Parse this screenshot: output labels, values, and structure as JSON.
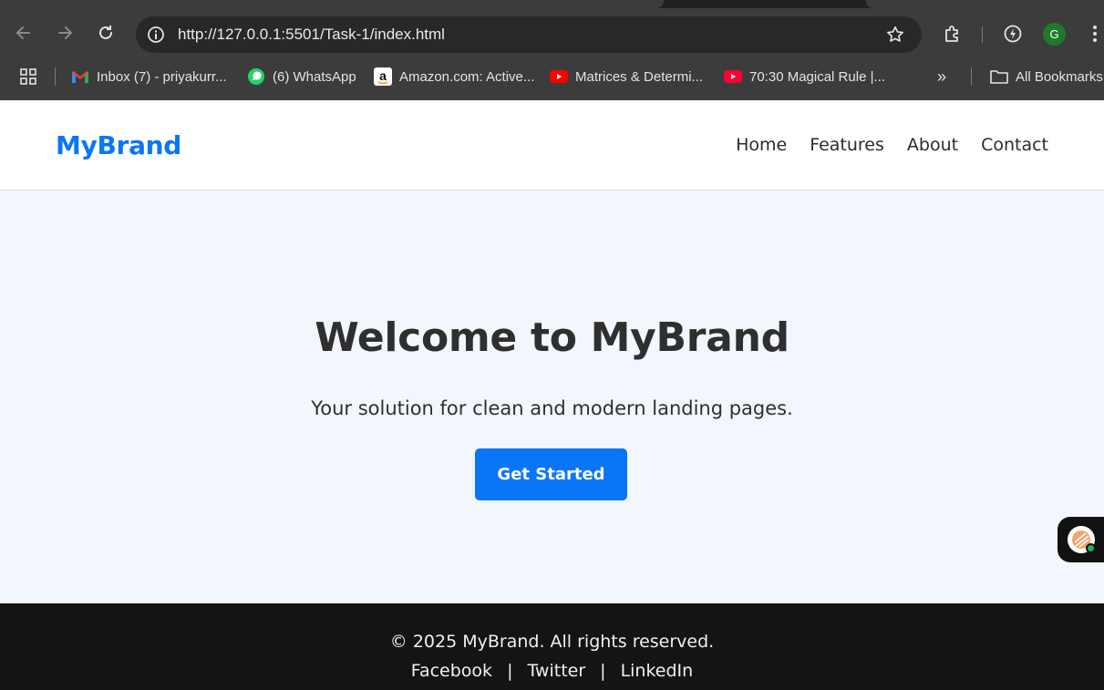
{
  "browser": {
    "url": "http://127.0.0.1:5501/Task-1/index.html",
    "profile_initial": "G",
    "bookmarks": [
      {
        "label": "Inbox (7) - priyakurr...",
        "icon": "gmail-icon"
      },
      {
        "label": "(6) WhatsApp",
        "icon": "whatsapp-icon"
      },
      {
        "label": "Amazon.com: Active...",
        "icon": "amazon-icon"
      },
      {
        "label": "Matrices & Determi...",
        "icon": "youtube-icon"
      },
      {
        "label": "70:30 Magical Rule |...",
        "icon": "youtube-icon"
      }
    ],
    "overflow_label": "»",
    "all_bookmarks_label": "All Bookmarks"
  },
  "header": {
    "brand": "MyBrand",
    "nav": [
      "Home",
      "Features",
      "About",
      "Contact"
    ]
  },
  "hero": {
    "title": "Welcome to MyBrand",
    "subtitle": "Your solution for clean and modern landing pages.",
    "cta_label": "Get Started"
  },
  "footer": {
    "copyright": "© 2025 MyBrand. All rights reserved.",
    "links": [
      "Facebook",
      "Twitter",
      "LinkedIn"
    ],
    "separator": "|"
  },
  "colors": {
    "accent": "#0a76f6",
    "hero_bg": "#f2f7fd",
    "footer_bg": "#141414",
    "chrome_bg": "#3c3c3c"
  }
}
